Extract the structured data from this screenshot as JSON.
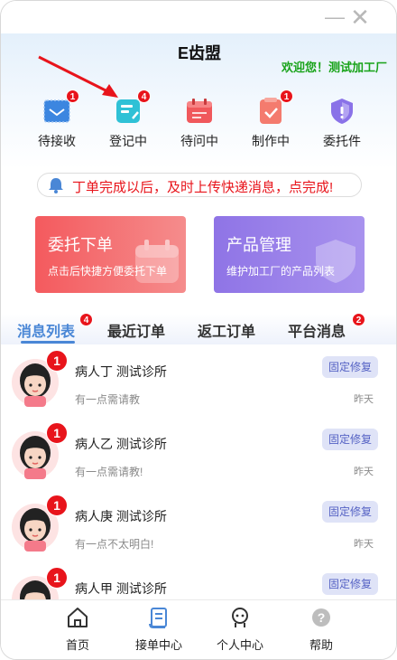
{
  "app": {
    "title": "E齿盟",
    "welcome": "欢迎您！测试加工厂"
  },
  "quick_actions": [
    {
      "label": "待接收",
      "badge": "1",
      "icon": "inbox-icon"
    },
    {
      "label": "登记中",
      "badge": "4",
      "icon": "register-icon"
    },
    {
      "label": "待问中",
      "badge": "",
      "icon": "calendar-icon"
    },
    {
      "label": "制作中",
      "badge": "1",
      "icon": "production-icon"
    },
    {
      "label": "委托件",
      "badge": "",
      "icon": "shield-icon"
    }
  ],
  "notice": {
    "text": "丁单完成以后，及时上传快递消息，点完成!",
    "icon": "bell-icon"
  },
  "cards": {
    "order": {
      "title": "委托下单",
      "subtitle": "点击后快捷方便委托下单"
    },
    "product": {
      "title": "产品管理",
      "subtitle": "维护加工厂的产品列表"
    }
  },
  "tabs": [
    {
      "label": "消息列表",
      "badge": "4",
      "active": true
    },
    {
      "label": "最近订单",
      "badge": "",
      "active": false
    },
    {
      "label": "返工订单",
      "badge": "",
      "active": false
    },
    {
      "label": "平台消息",
      "badge": "2",
      "active": false
    }
  ],
  "messages": [
    {
      "name": "病人丁 测试诊所",
      "tag": "固定修复",
      "preview": "有一点需请教",
      "time": "昨天",
      "badge": "1"
    },
    {
      "name": "病人乙 测试诊所",
      "tag": "固定修复",
      "preview": "有一点需请教!",
      "time": "昨天",
      "badge": "1"
    },
    {
      "name": "病人庚 测试诊所",
      "tag": "固定修复",
      "preview": "有一点不太明白!",
      "time": "昨天",
      "badge": "1"
    },
    {
      "name": "病人甲 测试诊所",
      "tag": "固定修复",
      "preview": "",
      "time": "",
      "badge": "1"
    }
  ],
  "bottom_nav": [
    {
      "label": "首页",
      "icon": "home-icon"
    },
    {
      "label": "接单中心",
      "icon": "order-center-icon"
    },
    {
      "label": "个人中心",
      "icon": "user-icon"
    },
    {
      "label": "帮助",
      "icon": "help-icon"
    }
  ],
  "colors": {
    "accent": "#4a87d6",
    "badge": "#e8141b",
    "welcome": "#19a319",
    "tag_bg": "#dfe3f7"
  }
}
